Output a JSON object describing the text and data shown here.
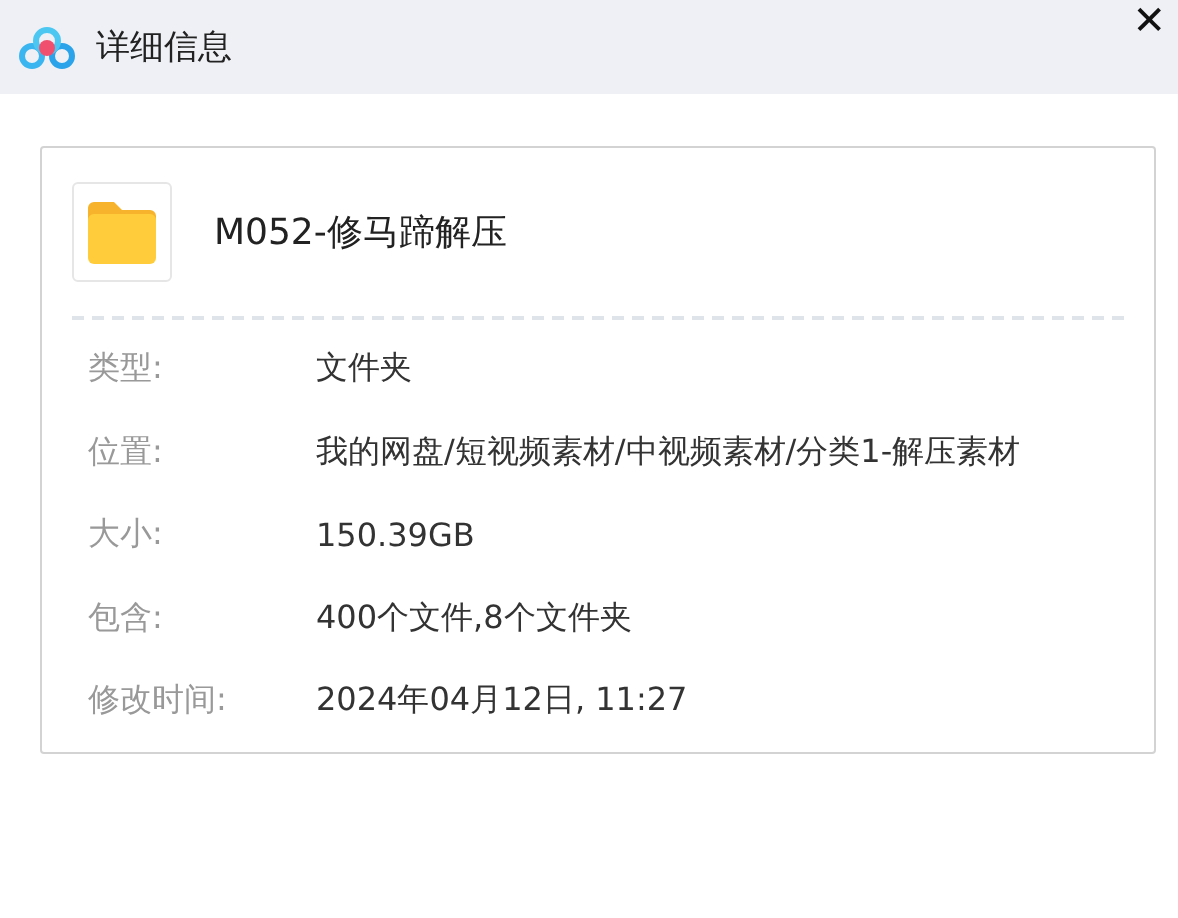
{
  "window": {
    "title": "详细信息",
    "close": "✕"
  },
  "file": {
    "name": "M052-修马蹄解压"
  },
  "details": [
    {
      "label": "类型:",
      "value": "文件夹"
    },
    {
      "label": "位置:",
      "value": "我的网盘/短视频素材/中视频素材/分类1-解压素材"
    },
    {
      "label": "大小:",
      "value": "150.39GB"
    },
    {
      "label": "包含:",
      "value": "400个文件,8个文件夹"
    },
    {
      "label": "修改时间:",
      "value": "2024年04月12日, 11:27"
    }
  ]
}
